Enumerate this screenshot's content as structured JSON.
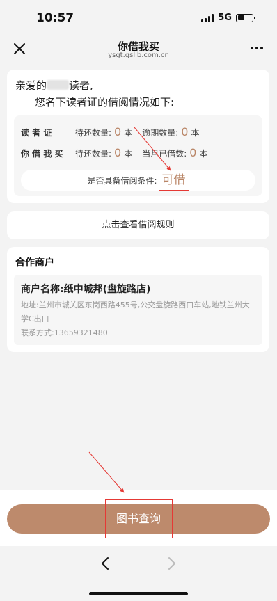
{
  "status_bar": {
    "time": "10:57",
    "network": "5G"
  },
  "nav": {
    "title": "你借我买",
    "subtitle": "ysgt.gslib.com.cn"
  },
  "greeting": {
    "prefix": "亲爱的",
    "suffix": "读者,",
    "line2": "您名下读者证的借阅情况如下:"
  },
  "stats": {
    "row1": {
      "label": "读 者 证",
      "k1": "待还数量:",
      "v1": "0",
      "u1": "本",
      "k2": "逾期数量:",
      "v2": "0",
      "u2": "本"
    },
    "row2": {
      "label": "你 借 我 买",
      "k1": "待还数量:",
      "v1": "0",
      "u1": "本",
      "k2": "当月已借数:",
      "v2": "0",
      "u2": "本"
    },
    "condition_label": "是否具备借阅条件:",
    "condition_value": "可借"
  },
  "rules_link": "点击查看借阅规则",
  "partner": {
    "title": "合作商户",
    "name": "商户名称:纸中城邦(盘旋路店)",
    "address": "地址:兰州市城关区东岗西路455号,公交盘旋路西口车站,地铁兰州大学C出口",
    "contact": "联系方式:13659321480"
  },
  "query_button": "图书查询",
  "colors": {
    "accent": "#bd8a6c",
    "number": "#b98566",
    "annotation": "#e53935"
  },
  "icons": {
    "close": "close-icon",
    "more": "more-icon",
    "back": "chevron-left-icon",
    "forward": "chevron-right-icon"
  }
}
